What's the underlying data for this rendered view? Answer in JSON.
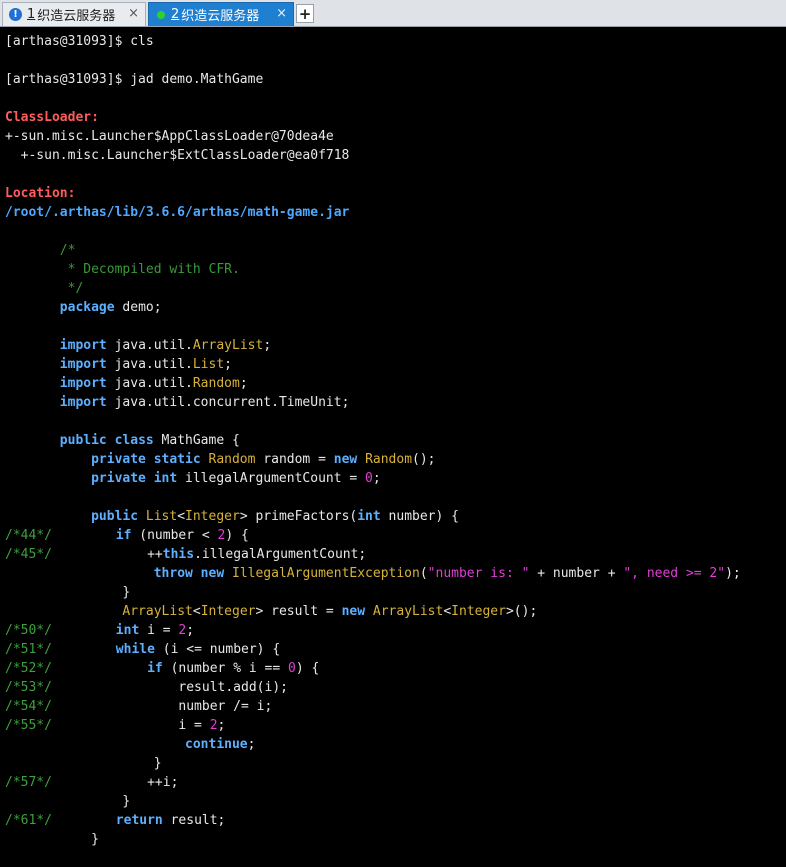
{
  "tabs": [
    {
      "number": "1",
      "title": "织造云服务器",
      "status": "alert-icon",
      "active": false
    },
    {
      "number": "2",
      "title": "织造云服务器",
      "status": "connected-dot-icon",
      "active": true
    }
  ],
  "new_tab_label": "+",
  "close_label": "×",
  "terminal": {
    "lines": [
      {
        "ln": "",
        "parts": [
          [
            "pr",
            "[arthas@31093]$ cls"
          ]
        ]
      },
      {
        "ln": "",
        "parts": []
      },
      {
        "ln": "",
        "parts": [
          [
            "pr",
            "[arthas@31093]$ jad demo.MathGame"
          ]
        ]
      },
      {
        "ln": "",
        "parts": []
      },
      {
        "ln": "",
        "parts": [
          [
            "err",
            "ClassLoader:"
          ]
        ]
      },
      {
        "ln": "",
        "parts": [
          [
            "tx",
            "+-sun.misc.Launcher$AppClassLoader@70dea4e"
          ]
        ]
      },
      {
        "ln": "",
        "parts": [
          [
            "tx",
            "  +-sun.misc.Launcher$ExtClassLoader@ea0f718"
          ]
        ]
      },
      {
        "ln": "",
        "parts": []
      },
      {
        "ln": "",
        "parts": [
          [
            "err",
            "Location:"
          ]
        ]
      },
      {
        "ln": "",
        "parts": [
          [
            "path",
            "/root/.arthas/lib/3.6.6/arthas/math-game.jar"
          ]
        ]
      },
      {
        "ln": "",
        "parts": []
      },
      {
        "ln": "",
        "parts": [
          [
            "tx",
            "       "
          ],
          [
            "cm",
            "/*"
          ]
        ]
      },
      {
        "ln": "",
        "parts": [
          [
            "tx",
            "       "
          ],
          [
            "cm",
            " * Decompiled with CFR."
          ]
        ]
      },
      {
        "ln": "",
        "parts": [
          [
            "tx",
            "       "
          ],
          [
            "cm",
            " */"
          ]
        ]
      },
      {
        "ln": "",
        "parts": [
          [
            "tx",
            "       "
          ],
          [
            "kw",
            "package"
          ],
          [
            "tx",
            " demo;"
          ]
        ]
      },
      {
        "ln": "",
        "parts": []
      },
      {
        "ln": "",
        "parts": [
          [
            "tx",
            "       "
          ],
          [
            "kw",
            "import"
          ],
          [
            "tx",
            " java.util."
          ],
          [
            "ty",
            "ArrayList"
          ],
          [
            "tx",
            ";"
          ]
        ]
      },
      {
        "ln": "",
        "parts": [
          [
            "tx",
            "       "
          ],
          [
            "kw",
            "import"
          ],
          [
            "tx",
            " java.util."
          ],
          [
            "ty",
            "List"
          ],
          [
            "tx",
            ";"
          ]
        ]
      },
      {
        "ln": "",
        "parts": [
          [
            "tx",
            "       "
          ],
          [
            "kw",
            "import"
          ],
          [
            "tx",
            " java.util."
          ],
          [
            "ty",
            "Random"
          ],
          [
            "tx",
            ";"
          ]
        ]
      },
      {
        "ln": "",
        "parts": [
          [
            "tx",
            "       "
          ],
          [
            "kw",
            "import"
          ],
          [
            "tx",
            " java.util.concurrent.TimeUnit;"
          ]
        ]
      },
      {
        "ln": "",
        "parts": []
      },
      {
        "ln": "",
        "parts": [
          [
            "tx",
            "       "
          ],
          [
            "kw",
            "public class"
          ],
          [
            "tx",
            " MathGame {"
          ]
        ]
      },
      {
        "ln": "",
        "parts": [
          [
            "tx",
            "           "
          ],
          [
            "kw",
            "private static"
          ],
          [
            "tx",
            " "
          ],
          [
            "ty",
            "Random"
          ],
          [
            "tx",
            " random = "
          ],
          [
            "kw",
            "new"
          ],
          [
            "tx",
            " "
          ],
          [
            "ty",
            "Random"
          ],
          [
            "tx",
            "();"
          ]
        ]
      },
      {
        "ln": "",
        "parts": [
          [
            "tx",
            "           "
          ],
          [
            "kw",
            "private int"
          ],
          [
            "tx",
            " illegalArgumentCount = "
          ],
          [
            "nm",
            "0"
          ],
          [
            "tx",
            ";"
          ]
        ]
      },
      {
        "ln": "",
        "parts": []
      },
      {
        "ln": "",
        "parts": [
          [
            "tx",
            "           "
          ],
          [
            "kw",
            "public"
          ],
          [
            "tx",
            " "
          ],
          [
            "ty",
            "List"
          ],
          [
            "tx",
            "<"
          ],
          [
            "ty",
            "Integer"
          ],
          [
            "tx",
            "> primeFactors("
          ],
          [
            "kw",
            "int"
          ],
          [
            "tx",
            " number) {"
          ]
        ]
      },
      {
        "ln": "/*44*/",
        "parts": [
          [
            "tx",
            "       "
          ],
          [
            "kw",
            "if"
          ],
          [
            "tx",
            " (number < "
          ],
          [
            "nm",
            "2"
          ],
          [
            "tx",
            ") {"
          ]
        ]
      },
      {
        "ln": "/*45*/",
        "parts": [
          [
            "tx",
            "           ++"
          ],
          [
            "kw",
            "this"
          ],
          [
            "tx",
            ".illegalArgumentCount;"
          ]
        ]
      },
      {
        "ln": "",
        "parts": [
          [
            "tx",
            "                   "
          ],
          [
            "kw",
            "throw new"
          ],
          [
            "tx",
            " "
          ],
          [
            "ty",
            "IllegalArgumentException"
          ],
          [
            "tx",
            "("
          ],
          [
            "st",
            "\"number is: \""
          ],
          [
            "tx",
            " + number + "
          ],
          [
            "st",
            "\", need >= 2\""
          ],
          [
            "tx",
            ");"
          ]
        ]
      },
      {
        "ln": "",
        "parts": [
          [
            "tx",
            "               }"
          ]
        ]
      },
      {
        "ln": "",
        "parts": [
          [
            "tx",
            "               "
          ],
          [
            "ty",
            "ArrayList"
          ],
          [
            "tx",
            "<"
          ],
          [
            "ty",
            "Integer"
          ],
          [
            "tx",
            "> result = "
          ],
          [
            "kw",
            "new"
          ],
          [
            "tx",
            " "
          ],
          [
            "ty",
            "ArrayList"
          ],
          [
            "tx",
            "<"
          ],
          [
            "ty",
            "Integer"
          ],
          [
            "tx",
            ">();"
          ]
        ]
      },
      {
        "ln": "/*50*/",
        "parts": [
          [
            "tx",
            "       "
          ],
          [
            "kw",
            "int"
          ],
          [
            "tx",
            " i = "
          ],
          [
            "nm",
            "2"
          ],
          [
            "tx",
            ";"
          ]
        ]
      },
      {
        "ln": "/*51*/",
        "parts": [
          [
            "tx",
            "       "
          ],
          [
            "kw",
            "while"
          ],
          [
            "tx",
            " (i <= number) {"
          ]
        ]
      },
      {
        "ln": "/*52*/",
        "parts": [
          [
            "tx",
            "           "
          ],
          [
            "kw",
            "if"
          ],
          [
            "tx",
            " (number % i == "
          ],
          [
            "nm",
            "0"
          ],
          [
            "tx",
            ") {"
          ]
        ]
      },
      {
        "ln": "/*53*/",
        "parts": [
          [
            "tx",
            "               result.add(i);"
          ]
        ]
      },
      {
        "ln": "/*54*/",
        "parts": [
          [
            "tx",
            "               number /= i;"
          ]
        ]
      },
      {
        "ln": "/*55*/",
        "parts": [
          [
            "tx",
            "               i = "
          ],
          [
            "nm",
            "2"
          ],
          [
            "tx",
            ";"
          ]
        ]
      },
      {
        "ln": "",
        "parts": [
          [
            "tx",
            "                       "
          ],
          [
            "kw",
            "continue"
          ],
          [
            "tx",
            ";"
          ]
        ]
      },
      {
        "ln": "",
        "parts": [
          [
            "tx",
            "                   }"
          ]
        ]
      },
      {
        "ln": "/*57*/",
        "parts": [
          [
            "tx",
            "           ++i;"
          ]
        ]
      },
      {
        "ln": "",
        "parts": [
          [
            "tx",
            "               }"
          ]
        ]
      },
      {
        "ln": "/*61*/",
        "parts": [
          [
            "tx",
            "       "
          ],
          [
            "kw",
            "return"
          ],
          [
            "tx",
            " result;"
          ]
        ]
      },
      {
        "ln": "",
        "parts": [
          [
            "tx",
            "           }"
          ]
        ]
      }
    ]
  }
}
